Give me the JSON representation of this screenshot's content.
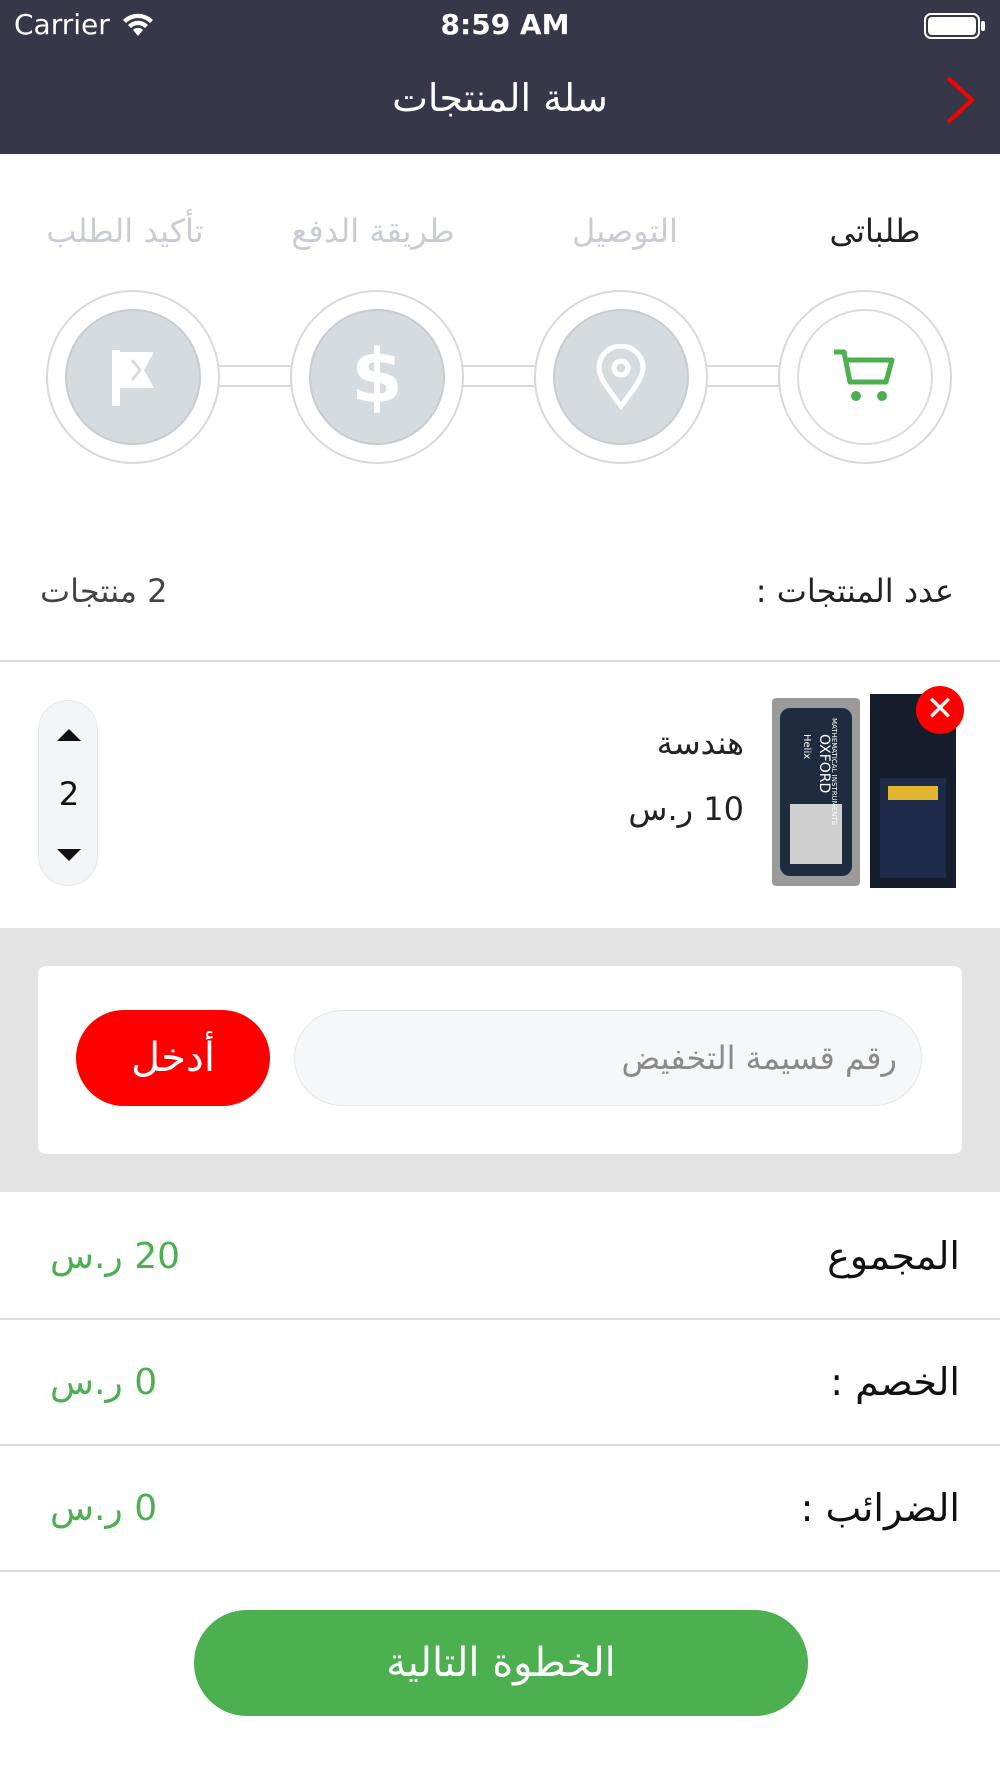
{
  "status_bar": {
    "carrier": "Carrier",
    "time": "8:59 AM"
  },
  "nav": {
    "title": "سلة المنتجات"
  },
  "steps": [
    {
      "label": "طلباتى",
      "icon": "cart-icon",
      "active": true
    },
    {
      "label": "التوصيل",
      "icon": "location-pin-icon",
      "active": false
    },
    {
      "label": "طريقة الدفع",
      "icon": "dollar-icon",
      "active": false
    },
    {
      "label": "تأكيد الطلب",
      "icon": "flag-icon",
      "active": false
    }
  ],
  "cart": {
    "count_label": "عدد المنتجات :",
    "count_value": "2 منتجات"
  },
  "product": {
    "name": "هندسة",
    "price": "10 ر.س",
    "quantity": "2",
    "image_text": {
      "brand": "Helix",
      "title": "OXFORD",
      "subtitle": "MATHEMATICAL INSTRUMENTS"
    }
  },
  "coupon": {
    "placeholder": "رقم قسيمة التخفيض",
    "apply_label": "أدخل"
  },
  "totals": {
    "subtotal_label": "المجموع",
    "subtotal_value": "20 ر.س",
    "discount_label": "الخصم :",
    "discount_value": "0 ر.س",
    "tax_label": "الضرائب :",
    "tax_value": "0 ر.س"
  },
  "next_label": "الخطوة التالية",
  "colors": {
    "header": "#363849",
    "accent_green": "#4caf50",
    "accent_red": "#ff0000"
  }
}
